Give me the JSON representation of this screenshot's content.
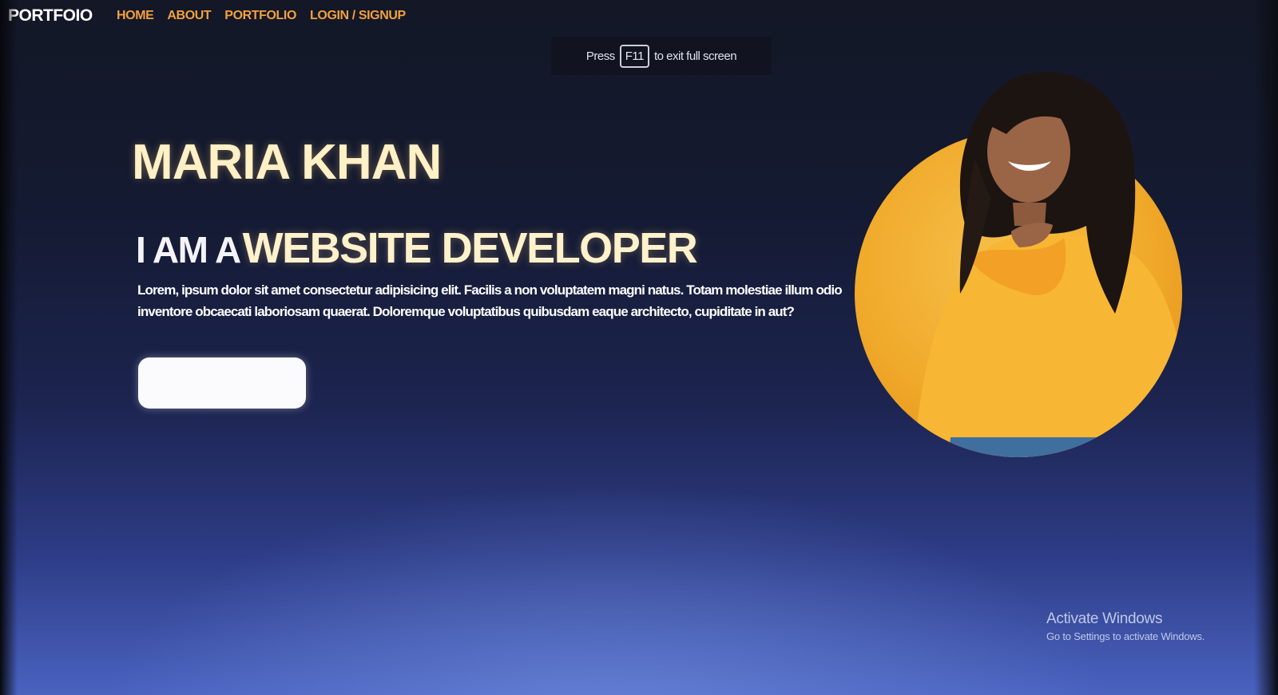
{
  "nav": {
    "brand": "PORTFOIO",
    "links": [
      "HOME",
      "ABOUT",
      "PORTFOLIO",
      "LOGIN / SIGNUP"
    ]
  },
  "fullscreen_notice": {
    "before": "Press",
    "key": "F11",
    "after": "to exit full screen"
  },
  "hero": {
    "name": "MARIA KHAN",
    "role_prefix": "I AM A",
    "role": "WEBSITE DEVELOPER",
    "description": "Lorem, ipsum dolor sit amet consectetur adipisicing elit. Facilis a non voluptatem magni natus. Totam molestiae illum odio inventore obcaecati laboriosam quaerat. Doloremque voluptatibus quibusdam eaque architecto, cupiditate in aut?",
    "cta_label": ""
  },
  "watermark": {
    "title": "Activate Windows",
    "subtitle": "Go to Settings to activate Windows."
  },
  "colors": {
    "accent_orange": "#f2a03d",
    "heading_cream": "#fff0c6",
    "portrait_circle": "#f3b63a"
  },
  "icons": [
    "portrait-photo"
  ]
}
